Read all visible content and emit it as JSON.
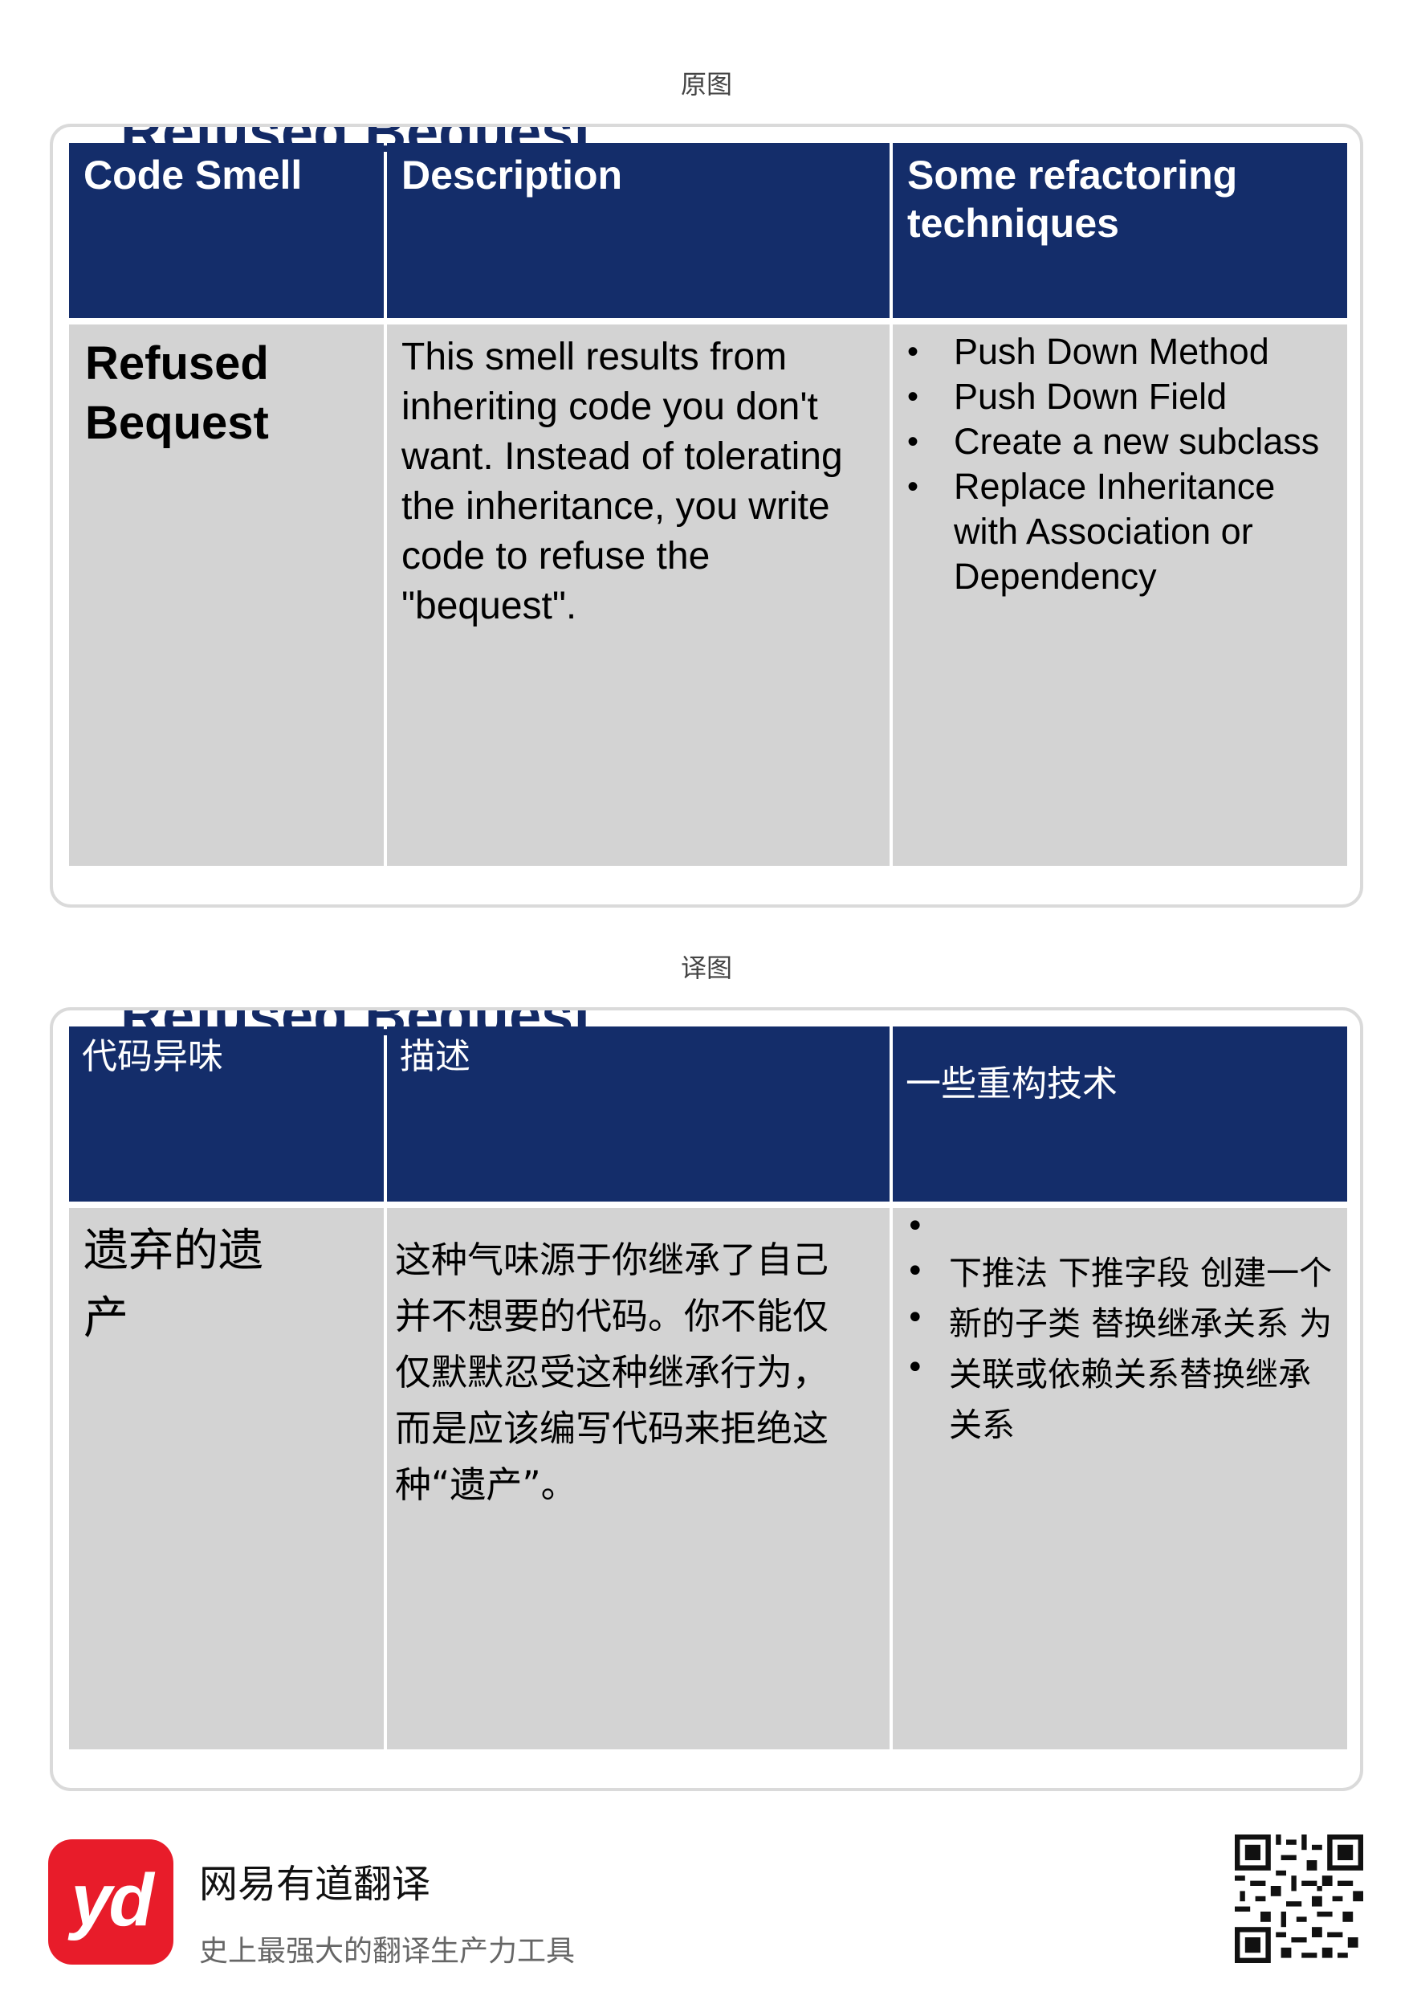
{
  "original": {
    "label": "原图",
    "cut_title": "Refused Bequest",
    "headers": [
      "Code Smell",
      "Description",
      "Some refactoring techniques"
    ],
    "smell_name": "Refused Bequest",
    "description": "This smell results from inheriting code you don't want. Instead of tolerating the inheritance, you write code to refuse the \"bequest\".",
    "techniques": [
      "Push Down Method",
      "Push Down Field",
      "Create a new subclass",
      "Replace Inheritance with Association or Dependency"
    ]
  },
  "translated": {
    "label": "译图",
    "cut_title": "Refused Bequest",
    "headers": [
      "代码异味",
      "描述",
      "一些重构技术"
    ],
    "smell_name": "遗弃的遗产",
    "description": "这种气味源于你继承了自己并不想要的代码。你不能仅仅默默忍受这种继承行为，而是应该编写代码来拒绝这种“遗产”。",
    "techniques_text": "下推法 下推字段 创建一个新的子类 替换继承关系 为关联或依赖关系替换继承关系"
  },
  "footer": {
    "logo_text": "yd",
    "app_name": "网易有道翻译",
    "slogan": "史上最强大的翻译生产力工具"
  },
  "colors": {
    "header_bg": "#142d6a",
    "body_bg": "#d3d3d3",
    "logo_bg": "#e81c2a"
  }
}
